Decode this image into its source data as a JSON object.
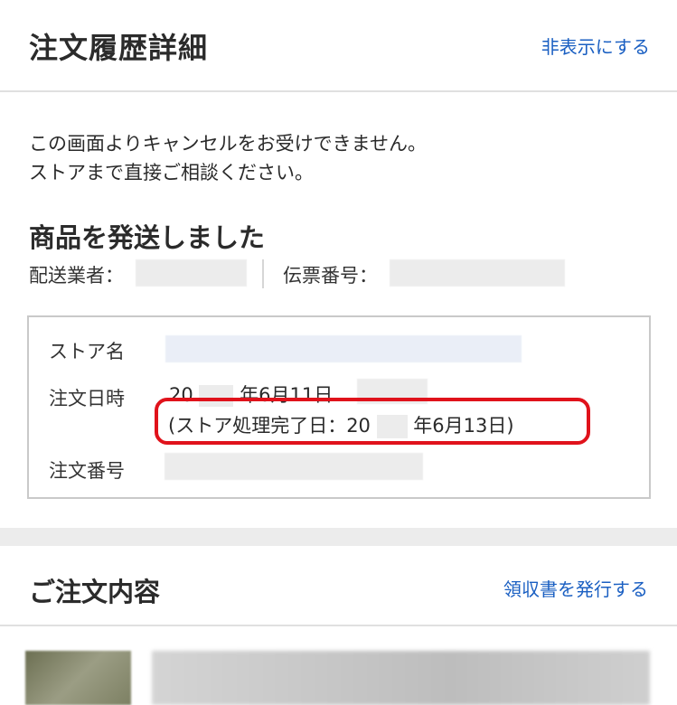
{
  "header": {
    "title": "注文履歴詳細",
    "hide_link": "非表示にする"
  },
  "notice": {
    "line1": "この画面よりキャンセルをお受けできません。",
    "line2": "ストアまで直接ご相談ください。"
  },
  "shipping": {
    "status": "商品を発送しました",
    "carrier_label": "配送業者：",
    "slip_label": "伝票番号："
  },
  "order_info": {
    "store_label": "ストア名",
    "date_label": "注文日時",
    "date_value_prefix": "20",
    "date_value_suffix": "年6月11日",
    "completion_prefix": "(ストア処理完了日：20",
    "completion_suffix": "年6月13日)",
    "number_label": "注文番号"
  },
  "order_contents": {
    "title": "ご注文内容",
    "receipt_link": "領収書を発行する"
  },
  "colors": {
    "link": "#1a5fc2",
    "highlight": "#e0121b"
  }
}
